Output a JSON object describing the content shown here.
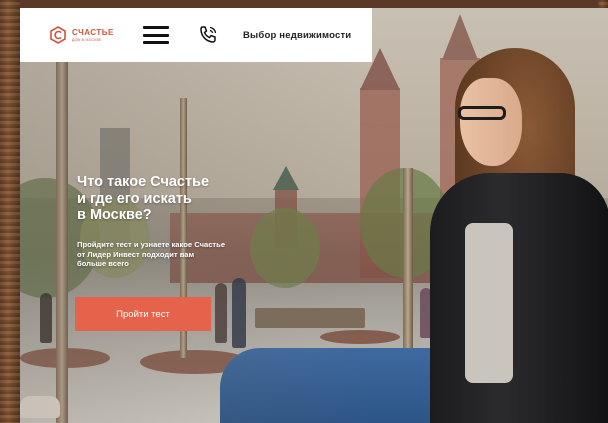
{
  "header": {
    "logo_title": "СЧАСТЬЕ",
    "logo_subtitle": "ДОМ В МОСКВЕ",
    "choose_link": "Выбор недвижимости"
  },
  "hero": {
    "title_lines": [
      "Что такое Счастье",
      "и где его искать",
      "в Москве?"
    ],
    "subtitle_lines": [
      "Пройдите тест и узнаете какое Счастье",
      "от Лидер Инвест подходит вам",
      "больше всего"
    ],
    "cta_label": "Пройти тест"
  },
  "colors": {
    "accent": "#e5634a",
    "logo": "#d2543b",
    "header_bg": "#ffffff"
  },
  "icons": {
    "logo": "logo-mark-icon",
    "menu": "hamburger-icon",
    "phone": "phone-icon"
  }
}
